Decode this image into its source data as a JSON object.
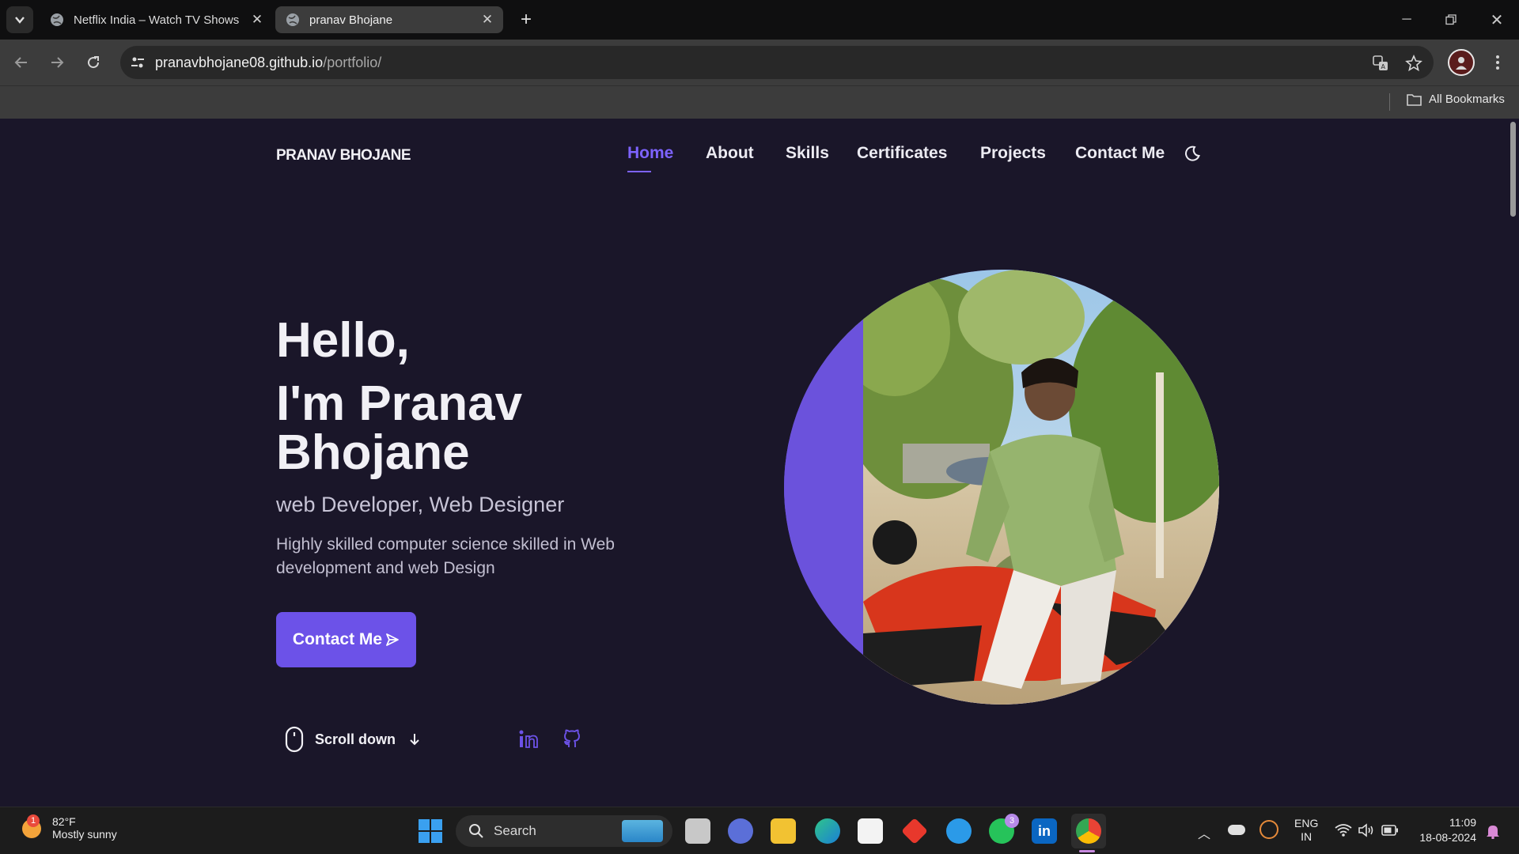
{
  "browser": {
    "tabs": [
      {
        "title": "Netflix India – Watch TV Shows",
        "active": false
      },
      {
        "title": "pranav Bhojane",
        "active": true
      }
    ],
    "url_host": "pranavbhojane08.github.io",
    "url_path": "/portfolio/",
    "bookmarks_label": "All Bookmarks"
  },
  "site": {
    "logo": "PRANAV BHOJANE",
    "nav": [
      "Home",
      "About",
      "Skills",
      "Certificates",
      "Projects",
      "Contact Me"
    ],
    "active_nav": "Home",
    "hero": {
      "greeting": "Hello,",
      "name": "I'm Pranav Bhojane",
      "subtitle": "web Developer, Web Designer",
      "description": "Highly skilled computer science skilled in Web development and web Design",
      "cta": "Contact Me",
      "scroll": "Scroll down"
    },
    "colors": {
      "accent": "#6c52e8",
      "background": "#1a1629"
    }
  },
  "taskbar": {
    "weather_temp": "82°F",
    "weather_desc": "Mostly sunny",
    "weather_badge": "1",
    "search": "Search",
    "whatsapp_badge": "3",
    "lang1": "ENG",
    "lang2": "IN",
    "time": "11:09",
    "date": "18-08-2024"
  }
}
